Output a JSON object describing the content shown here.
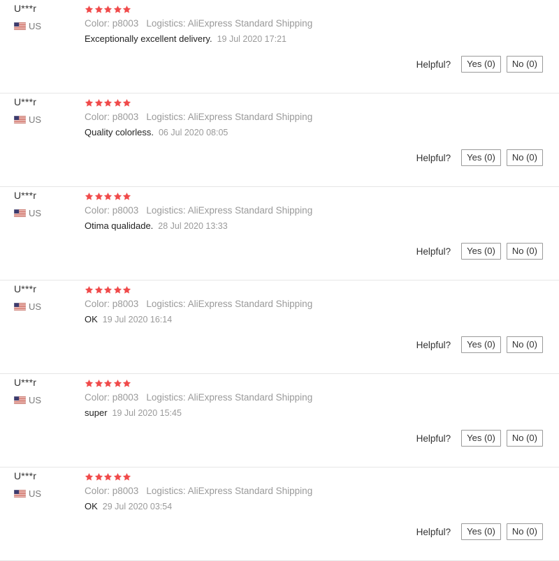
{
  "colors": {
    "star": "#f04a4a",
    "meta_text": "#9a9a9a",
    "border": "#e6e6e6"
  },
  "reviews": [
    {
      "user": "U***r",
      "country": "US",
      "flag_icon": "us-flag-icon",
      "rating": 5,
      "color_label": "Color: p8003",
      "logistics": "Logistics: AliExpress Standard Shipping",
      "text": "Exceptionally excellent delivery.",
      "date": "19 Jul 2020 17:21",
      "helpful_label": "Helpful?",
      "yes_label": "Yes (0)",
      "no_label": "No (0)"
    },
    {
      "user": "U***r",
      "country": "US",
      "flag_icon": "us-flag-icon",
      "rating": 5,
      "color_label": "Color: p8003",
      "logistics": "Logistics: AliExpress Standard Shipping",
      "text": "Quality colorless.",
      "date": "06 Jul 2020 08:05",
      "helpful_label": "Helpful?",
      "yes_label": "Yes (0)",
      "no_label": "No (0)"
    },
    {
      "user": "U***r",
      "country": "US",
      "flag_icon": "us-flag-icon",
      "rating": 5,
      "color_label": "Color: p8003",
      "logistics": "Logistics: AliExpress Standard Shipping",
      "text": "Otima qualidade.",
      "date": "28 Jul 2020 13:33",
      "helpful_label": "Helpful?",
      "yes_label": "Yes (0)",
      "no_label": "No (0)"
    },
    {
      "user": "U***r",
      "country": "US",
      "flag_icon": "us-flag-icon",
      "rating": 5,
      "color_label": "Color: p8003",
      "logistics": "Logistics: AliExpress Standard Shipping",
      "text": "OK",
      "date": "19 Jul 2020 16:14",
      "helpful_label": "Helpful?",
      "yes_label": "Yes (0)",
      "no_label": "No (0)"
    },
    {
      "user": "U***r",
      "country": "US",
      "flag_icon": "us-flag-icon",
      "rating": 5,
      "color_label": "Color: p8003",
      "logistics": "Logistics: AliExpress Standard Shipping",
      "text": "super",
      "date": "19 Jul 2020 15:45",
      "helpful_label": "Helpful?",
      "yes_label": "Yes (0)",
      "no_label": "No (0)"
    },
    {
      "user": "U***r",
      "country": "US",
      "flag_icon": "us-flag-icon",
      "rating": 5,
      "color_label": "Color: p8003",
      "logistics": "Logistics: AliExpress Standard Shipping",
      "text": "OK",
      "date": "29 Jul 2020 03:54",
      "helpful_label": "Helpful?",
      "yes_label": "Yes (0)",
      "no_label": "No (0)"
    }
  ]
}
